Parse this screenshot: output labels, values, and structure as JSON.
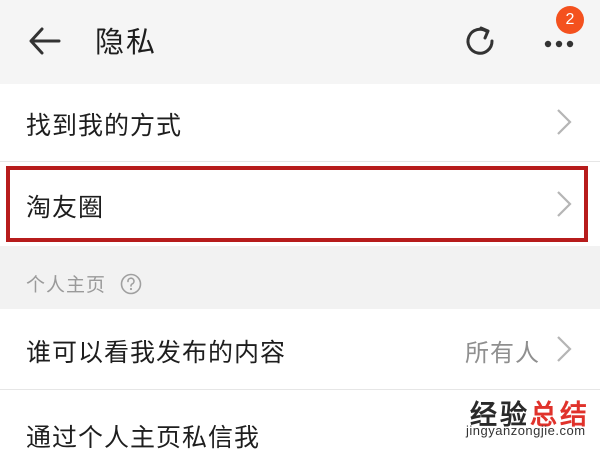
{
  "header": {
    "title": "隐私",
    "back_icon": "arrow-left-icon",
    "refresh_icon": "refresh-icon",
    "more_icon": "more-dots-icon",
    "badge_count": "2"
  },
  "rows": [
    {
      "label": "找到我的方式",
      "value": ""
    },
    {
      "label": "淘友圈",
      "value": ""
    }
  ],
  "section": {
    "label": "个人主页",
    "help_icon": "question-circle-icon"
  },
  "section_rows": [
    {
      "label": "谁可以看我发布的内容",
      "value": "所有人"
    },
    {
      "label": "通过个人主页私信我",
      "value": ""
    }
  ],
  "watermark": {
    "text": "经验总结",
    "url": "jingyanzongjie.com"
  },
  "colors": {
    "background": "#f2f2f2",
    "row_bg": "#ffffff",
    "highlight_border": "#b71c1c",
    "badge": "#f4511e",
    "secondary_text": "#8f8f8f"
  }
}
